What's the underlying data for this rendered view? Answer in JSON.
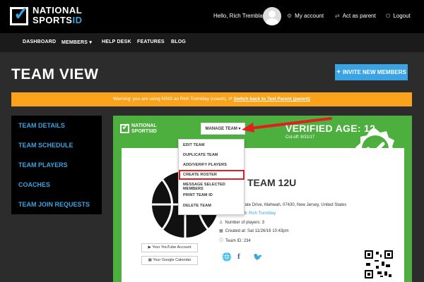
{
  "header": {
    "logo_line1": "NATIONAL",
    "logo_line2a": "SPORTS",
    "logo_line2b": "ID",
    "greeting": "Hello, Rich Tremblay",
    "my_account": "My account",
    "act_as_parent": "Act as parent",
    "logout": "Logout"
  },
  "nav": {
    "dashboard": "DASHBOARD",
    "members": "MEMBERS",
    "help_desk": "HELP DESK",
    "features": "FEATURES",
    "blog": "BLOG"
  },
  "page": {
    "title": "TEAM VIEW",
    "invite_label": "INVITE NEW MEMBERS"
  },
  "warning": {
    "text": "Warning: you are using NSID as Rich Tremblay (coach).",
    "link": "Switch back to Test Parent (parent)"
  },
  "sidebar": {
    "items": [
      "TEAM DETAILS",
      "TEAM SCHEDULE",
      "TEAM PLAYERS",
      "COACHES",
      "TEAM JOIN REQUESTS"
    ]
  },
  "card": {
    "logo_line1": "NATIONAL",
    "logo_line2": "SPORTSID",
    "manage_team": "MANAGE TEAM",
    "verified_age": "VERIFIED AGE: 12",
    "cutoff": "Cut-off: 8/31/17",
    "team_name": "TEAM 12U",
    "address": "101 Corporate Drive, Mahwah, 07430, New Jersey, United States",
    "head_coach_label": "Head coach:",
    "head_coach": "Rich Tremblay",
    "players": "Number of players: 3",
    "created": "Created at: Sat 11/26/16 10:43pm",
    "team_id": "Team ID: 234",
    "youtube": "Your YouTube Account",
    "google_calendar": "Your Google Calendar"
  },
  "dropdown": {
    "items": [
      "EDIT TEAM",
      "DUPLICATE TEAM",
      "ADD/VERIFY PLAYERS",
      "CREATE ROSTER",
      "MESSAGE SELECTED MEMBERS",
      "PRINT TEAM ID",
      "DELETE TEAM"
    ],
    "highlighted": "CREATE ROSTER"
  },
  "colors": {
    "accent_blue": "#3aa3e3",
    "green": "#4caf3e",
    "warning_orange": "#f9a21b",
    "highlight_red": "#e02020"
  }
}
